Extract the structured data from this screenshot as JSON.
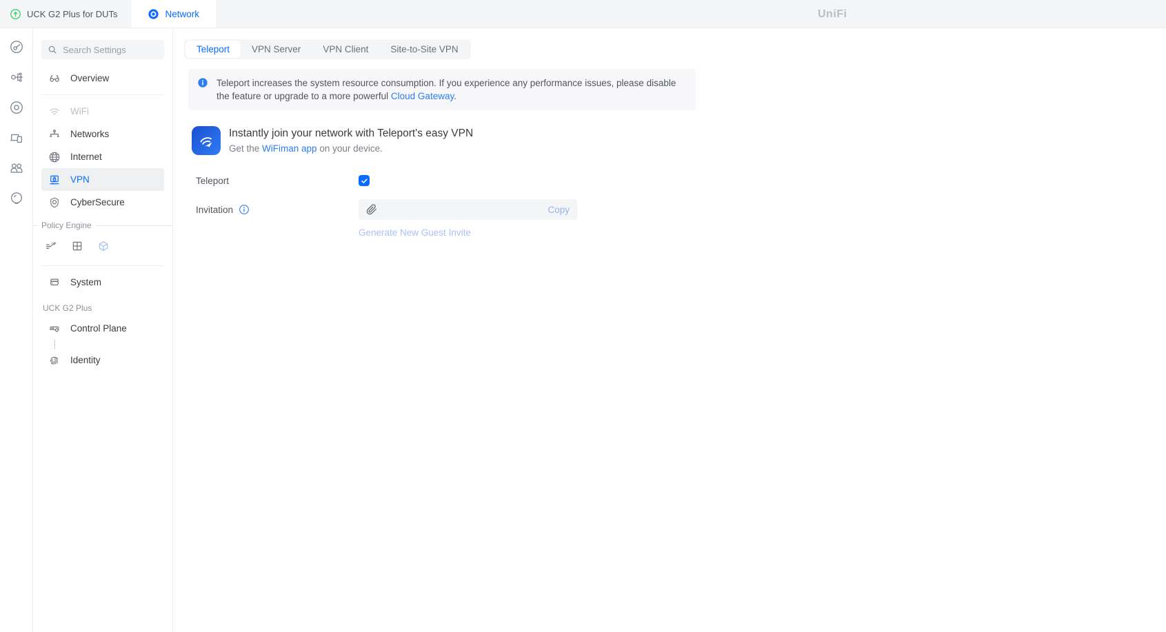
{
  "topbar": {
    "site_tab": "UCK G2 Plus for DUTs",
    "app_tab": "Network",
    "logo": "UniFi"
  },
  "rail": {
    "items": [
      "dashboard",
      "topology",
      "unifi-devices",
      "client-devices",
      "admins",
      "insights"
    ]
  },
  "sidebar": {
    "search_placeholder": "Search Settings",
    "items": [
      {
        "label": "Overview"
      },
      {
        "label": "WiFi",
        "disabled": true
      },
      {
        "label": "Networks"
      },
      {
        "label": "Internet"
      },
      {
        "label": "VPN",
        "selected": true
      },
      {
        "label": "CyberSecure"
      }
    ],
    "policy_engine_label": "Policy Engine",
    "system_label": "System",
    "device_section_label": "UCK G2 Plus",
    "control_plane_label": "Control Plane",
    "identity_label": "Identity"
  },
  "tabs": [
    {
      "label": "Teleport",
      "active": true
    },
    {
      "label": "VPN Server"
    },
    {
      "label": "VPN Client"
    },
    {
      "label": "Site-to-Site VPN"
    }
  ],
  "banner": {
    "text_before": "Teleport increases the system resource consumption. If you experience any performance issues, please disable the feature or upgrade to a more powerful ",
    "link_text": "Cloud Gateway",
    "text_after": "."
  },
  "card": {
    "title": "Instantly join your network with Teleport's easy VPN",
    "subtitle_before": "Get the ",
    "subtitle_link": "WiFiman app",
    "subtitle_after": " on your device."
  },
  "form": {
    "teleport_label": "Teleport",
    "teleport_enabled": true,
    "invitation_label": "Invitation",
    "invitation_value": "",
    "copy_label": "Copy",
    "generate_label": "Generate New Guest Invite"
  },
  "colors": {
    "accent_blue": "#0a6cff",
    "link_blue": "#2e7cf0",
    "disabled_link_blue": "#a9c3f3",
    "green": "#38cc65",
    "topbar_bg": "#f4f5f6",
    "selected_row_bg": "#eef0f1",
    "banner_bg": "#f7f7f9",
    "logo_gray": "#b9bec5"
  }
}
